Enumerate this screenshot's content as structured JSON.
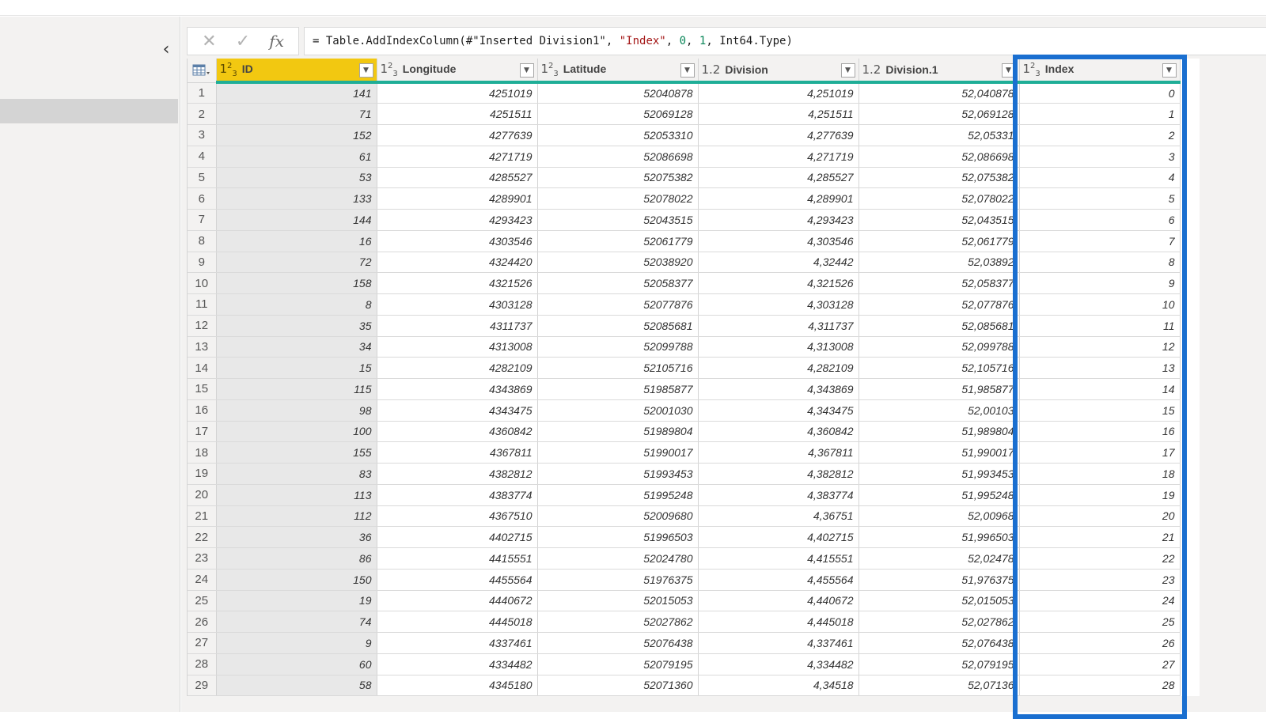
{
  "formula_bar": {
    "cancel_icon": "close-icon",
    "confirm_icon": "check-icon",
    "fx_label": "fx",
    "formula_parts": [
      {
        "text": "= Table.AddIndexColumn(#\"Inserted Division1\", ",
        "kind": "plain"
      },
      {
        "text": "\"Index\"",
        "kind": "str"
      },
      {
        "text": ", ",
        "kind": "plain"
      },
      {
        "text": "0",
        "kind": "num"
      },
      {
        "text": ", ",
        "kind": "plain"
      },
      {
        "text": "1",
        "kind": "num"
      },
      {
        "text": ", Int64.Type)",
        "kind": "plain"
      }
    ]
  },
  "left_panel": {
    "collapse_icon": "chevron-left-icon"
  },
  "table": {
    "columns": [
      {
        "name": "ID",
        "type_label": "123",
        "selected": true
      },
      {
        "name": "Longitude",
        "type_label": "123",
        "selected": false
      },
      {
        "name": "Latitude",
        "type_label": "123",
        "selected": false
      },
      {
        "name": "Division",
        "type_label": "1.2",
        "selected": false
      },
      {
        "name": "Division.1",
        "type_label": "1.2",
        "selected": false
      },
      {
        "name": "Index",
        "type_label": "123",
        "selected": false,
        "highlighted": true
      }
    ],
    "rows": [
      [
        "1",
        "141",
        "4251019",
        "52040878",
        "4,251019",
        "52,040878",
        "0"
      ],
      [
        "2",
        "71",
        "4251511",
        "52069128",
        "4,251511",
        "52,069128",
        "1"
      ],
      [
        "3",
        "152",
        "4277639",
        "52053310",
        "4,277639",
        "52,05331",
        "2"
      ],
      [
        "4",
        "61",
        "4271719",
        "52086698",
        "4,271719",
        "52,086698",
        "3"
      ],
      [
        "5",
        "53",
        "4285527",
        "52075382",
        "4,285527",
        "52,075382",
        "4"
      ],
      [
        "6",
        "133",
        "4289901",
        "52078022",
        "4,289901",
        "52,078022",
        "5"
      ],
      [
        "7",
        "144",
        "4293423",
        "52043515",
        "4,293423",
        "52,043515",
        "6"
      ],
      [
        "8",
        "16",
        "4303546",
        "52061779",
        "4,303546",
        "52,061779",
        "7"
      ],
      [
        "9",
        "72",
        "4324420",
        "52038920",
        "4,32442",
        "52,03892",
        "8"
      ],
      [
        "10",
        "158",
        "4321526",
        "52058377",
        "4,321526",
        "52,058377",
        "9"
      ],
      [
        "11",
        "8",
        "4303128",
        "52077876",
        "4,303128",
        "52,077876",
        "10"
      ],
      [
        "12",
        "35",
        "4311737",
        "52085681",
        "4,311737",
        "52,085681",
        "11"
      ],
      [
        "13",
        "34",
        "4313008",
        "52099788",
        "4,313008",
        "52,099788",
        "12"
      ],
      [
        "14",
        "15",
        "4282109",
        "52105716",
        "4,282109",
        "52,105716",
        "13"
      ],
      [
        "15",
        "115",
        "4343869",
        "51985877",
        "4,343869",
        "51,985877",
        "14"
      ],
      [
        "16",
        "98",
        "4343475",
        "52001030",
        "4,343475",
        "52,00103",
        "15"
      ],
      [
        "17",
        "100",
        "4360842",
        "51989804",
        "4,360842",
        "51,989804",
        "16"
      ],
      [
        "18",
        "155",
        "4367811",
        "51990017",
        "4,367811",
        "51,990017",
        "17"
      ],
      [
        "19",
        "83",
        "4382812",
        "51993453",
        "4,382812",
        "51,993453",
        "18"
      ],
      [
        "20",
        "113",
        "4383774",
        "51995248",
        "4,383774",
        "51,995248",
        "19"
      ],
      [
        "21",
        "112",
        "4367510",
        "52009680",
        "4,36751",
        "52,00968",
        "20"
      ],
      [
        "22",
        "36",
        "4402715",
        "51996503",
        "4,402715",
        "51,996503",
        "21"
      ],
      [
        "23",
        "86",
        "4415551",
        "52024780",
        "4,415551",
        "52,02478",
        "22"
      ],
      [
        "24",
        "150",
        "4455564",
        "51976375",
        "4,455564",
        "51,976375",
        "23"
      ],
      [
        "25",
        "19",
        "4440672",
        "52015053",
        "4,440672",
        "52,015053",
        "24"
      ],
      [
        "26",
        "74",
        "4445018",
        "52027862",
        "4,445018",
        "52,027862",
        "25"
      ],
      [
        "27",
        "9",
        "4337461",
        "52076438",
        "4,337461",
        "52,076438",
        "26"
      ],
      [
        "28",
        "60",
        "4334482",
        "52079195",
        "4,334482",
        "52,079195",
        "27"
      ],
      [
        "29",
        "58",
        "4345180",
        "52071360",
        "4,34518",
        "52,07136",
        "28"
      ]
    ]
  },
  "colors": {
    "selected_header": "#f2c811",
    "column_quality_bar": "#1fae97",
    "highlight_box": "#1a6fd0"
  }
}
